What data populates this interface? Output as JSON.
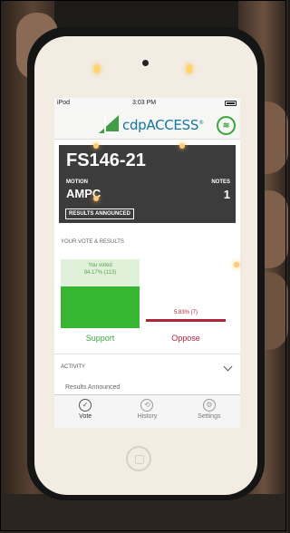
{
  "status_bar": {
    "carrier": "iPod",
    "time": "3:03 PM"
  },
  "app": {
    "logo_text": "cdpACCESS",
    "logo_reg": "®"
  },
  "motion": {
    "id": "FS146-21",
    "motion_label": "MOTION",
    "motion_name": "AMPC",
    "notes_label": "NOTES",
    "notes_count": "1",
    "status": "RESULTS ANNOUNCED"
  },
  "results": {
    "title": "YOUR VOTE & RESULTS",
    "support": {
      "note": "You voted",
      "value": "94.17% (113)",
      "label": "Support",
      "fraction": 0.9417
    },
    "oppose": {
      "value": "5.83% (7)",
      "label": "Oppose",
      "fraction": 0.0583
    }
  },
  "activity": {
    "title": "ACTIVITY",
    "entry": "Results Announced"
  },
  "tabs": [
    {
      "label": "Vote",
      "icon": "check-circle-icon",
      "active": true
    },
    {
      "label": "History",
      "icon": "history-icon",
      "active": false
    },
    {
      "label": "Settings",
      "icon": "gear-icon",
      "active": false
    }
  ],
  "colors": {
    "support": "#37b631",
    "oppose": "#b0223a",
    "brand_blue": "#14779e",
    "brand_green": "#3f9e43",
    "header_dark": "#3c3c3c"
  }
}
